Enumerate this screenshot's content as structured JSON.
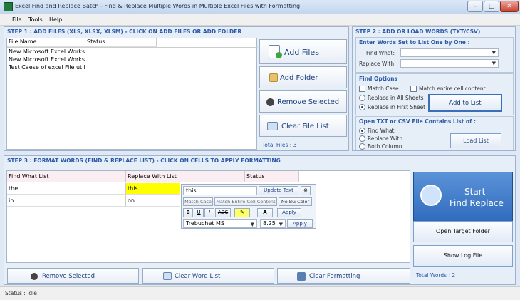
{
  "window": {
    "title": "Excel Find and Replace Batch - Find & Replace Multiple Words in Multiple Excel Files with Formatting",
    "min": "–",
    "max": "□",
    "close": "✕"
  },
  "menu": [
    "File",
    "Tools",
    "Help"
  ],
  "step1": {
    "header": "STEP 1 : ADD FILES (XLS, XLSX, XLSM) - CLICK ON ADD FILES OR ADD FOLDER",
    "columns": [
      "File Name",
      "Status"
    ],
    "rows": [
      {
        "name": "New Microsoft Excel Works...",
        "status": ""
      },
      {
        "name": "New Microsoft Excel Works...",
        "status": ""
      },
      {
        "name": "Test Caese of excel File util...",
        "status": ""
      }
    ],
    "add_files": "Add Files",
    "add_folder": "Add Folder",
    "remove_selected": "Remove Selected",
    "clear_file_list": "Clear File List",
    "total_files": "Total Files : 3"
  },
  "step2": {
    "header": "STEP 2 : ADD OR LOAD WORDS (TXT/CSV)",
    "enter_words": "Enter Words Set to List One by One :",
    "find_what_label": "Find What:",
    "find_what_value": "",
    "replace_with_label": "Replace With:",
    "replace_with_value": "",
    "find_options": "Find Options",
    "match_case": "Match Case",
    "match_entire": "Match entire cell content",
    "replace_all_sheets": "Replace in All Sheets",
    "replace_first_sheet": "Replace in First Sheet",
    "add_to_list": "Add to List",
    "open_txt_csv": "Open TXT or CSV File Contains List of :",
    "opt_find_what": "Find What",
    "opt_replace_with": "Replace With",
    "opt_both_column": "Both Column",
    "load_list": "Load List"
  },
  "step3": {
    "header": "STEP 3 : FORMAT WORDS (FIND & REPLACE LIST) - CLICK ON CELLS TO APPLY FORMATTING",
    "columns": [
      "Find What List",
      "Replace With List",
      "Status"
    ],
    "rows": [
      {
        "find": "the",
        "replace": "this",
        "status": ""
      },
      {
        "find": "in",
        "replace": "on",
        "status": ""
      }
    ],
    "editor": {
      "text_value": "this",
      "update_text": "Update Text",
      "match_case": "Match Case",
      "match_entire": "Match Entire Cell Content",
      "no_bg_color": "No BG Color",
      "bold": "B",
      "underline": "U",
      "italic": "I",
      "strike": "ABC",
      "apply1": "Apply",
      "font_name": "Trebuchet MS",
      "font_size": "8.25",
      "apply2": "Apply"
    },
    "remove_selected": "Remove Selected",
    "clear_word_list": "Clear Word List",
    "clear_formatting": "Clear Formatting"
  },
  "right": {
    "start_line1": "Start",
    "start_line2": "Find Replace",
    "open_target": "Open Target Folder",
    "show_log": "Show Log File",
    "total_words": "Total Words : 2"
  },
  "status": "Status  :  Idle!",
  "colors": {
    "accent": "#2d5aa8",
    "highlight": "#ffff00",
    "start_bg": "#4a85d0"
  }
}
